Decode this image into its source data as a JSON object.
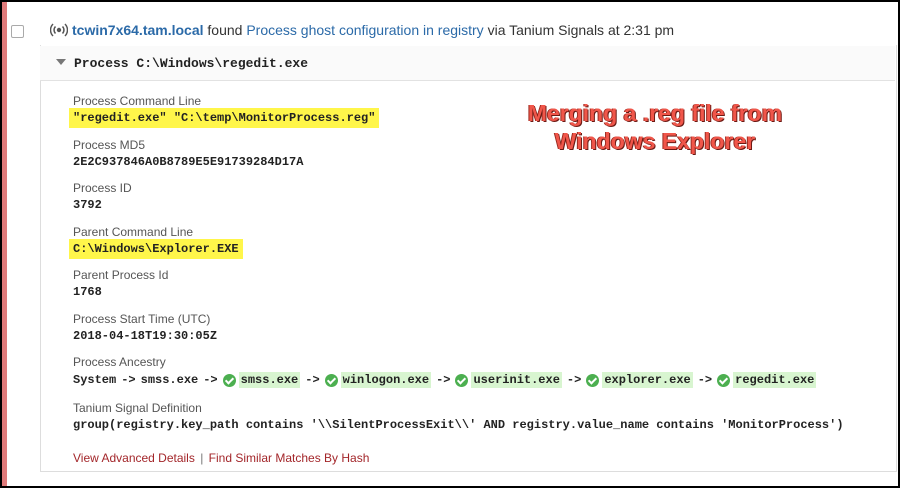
{
  "header": {
    "hostname": "tcwin7x64.tam.local",
    "found_text": " found ",
    "signal_name": "Process ghost configuration in registry",
    "via_text": " via Tanium Signals at 2:31 pm"
  },
  "process": {
    "title": "Process C:\\Windows\\regedit.exe"
  },
  "fields": {
    "command_line": {
      "label": "Process Command Line",
      "value": "\"regedit.exe\" \"C:\\temp\\MonitorProcess.reg\""
    },
    "md5": {
      "label": "Process MD5",
      "value": "2E2C937846A0B8789E5E91739284D17A"
    },
    "pid": {
      "label": "Process ID",
      "value": "3792"
    },
    "parent_command_line": {
      "label": "Parent Command Line",
      "value": "C:\\Windows\\Explorer.EXE"
    },
    "parent_pid": {
      "label": "Parent Process Id",
      "value": "1768"
    },
    "start_time": {
      "label": "Process Start Time (UTC)",
      "value": "2018-04-18T19:30:05Z"
    },
    "ancestry_label": "Process Ancestry",
    "signal_definition": {
      "label": "Tanium Signal Definition",
      "value": "group(registry.key_path contains '\\\\SilentProcessExit\\\\' AND registry.value_name contains 'MonitorProcess')"
    }
  },
  "ancestry": {
    "root1": "System",
    "root2": "smss.exe",
    "arrow": "->",
    "items": [
      "smss.exe",
      "winlogon.exe",
      "userinit.exe",
      "explorer.exe",
      "regedit.exe"
    ]
  },
  "links": {
    "advanced": "View Advanced Details",
    "separator": "|",
    "similar": "Find Similar Matches By Hash"
  },
  "annotation": {
    "line1": "Merging a .reg file from",
    "line2": "Windows Explorer"
  },
  "colors": {
    "accent": "#e07b7b",
    "link": "#2b6aa8",
    "highlight": "#fff64a",
    "annotation": "#f0564a",
    "check": "#4caf50"
  }
}
